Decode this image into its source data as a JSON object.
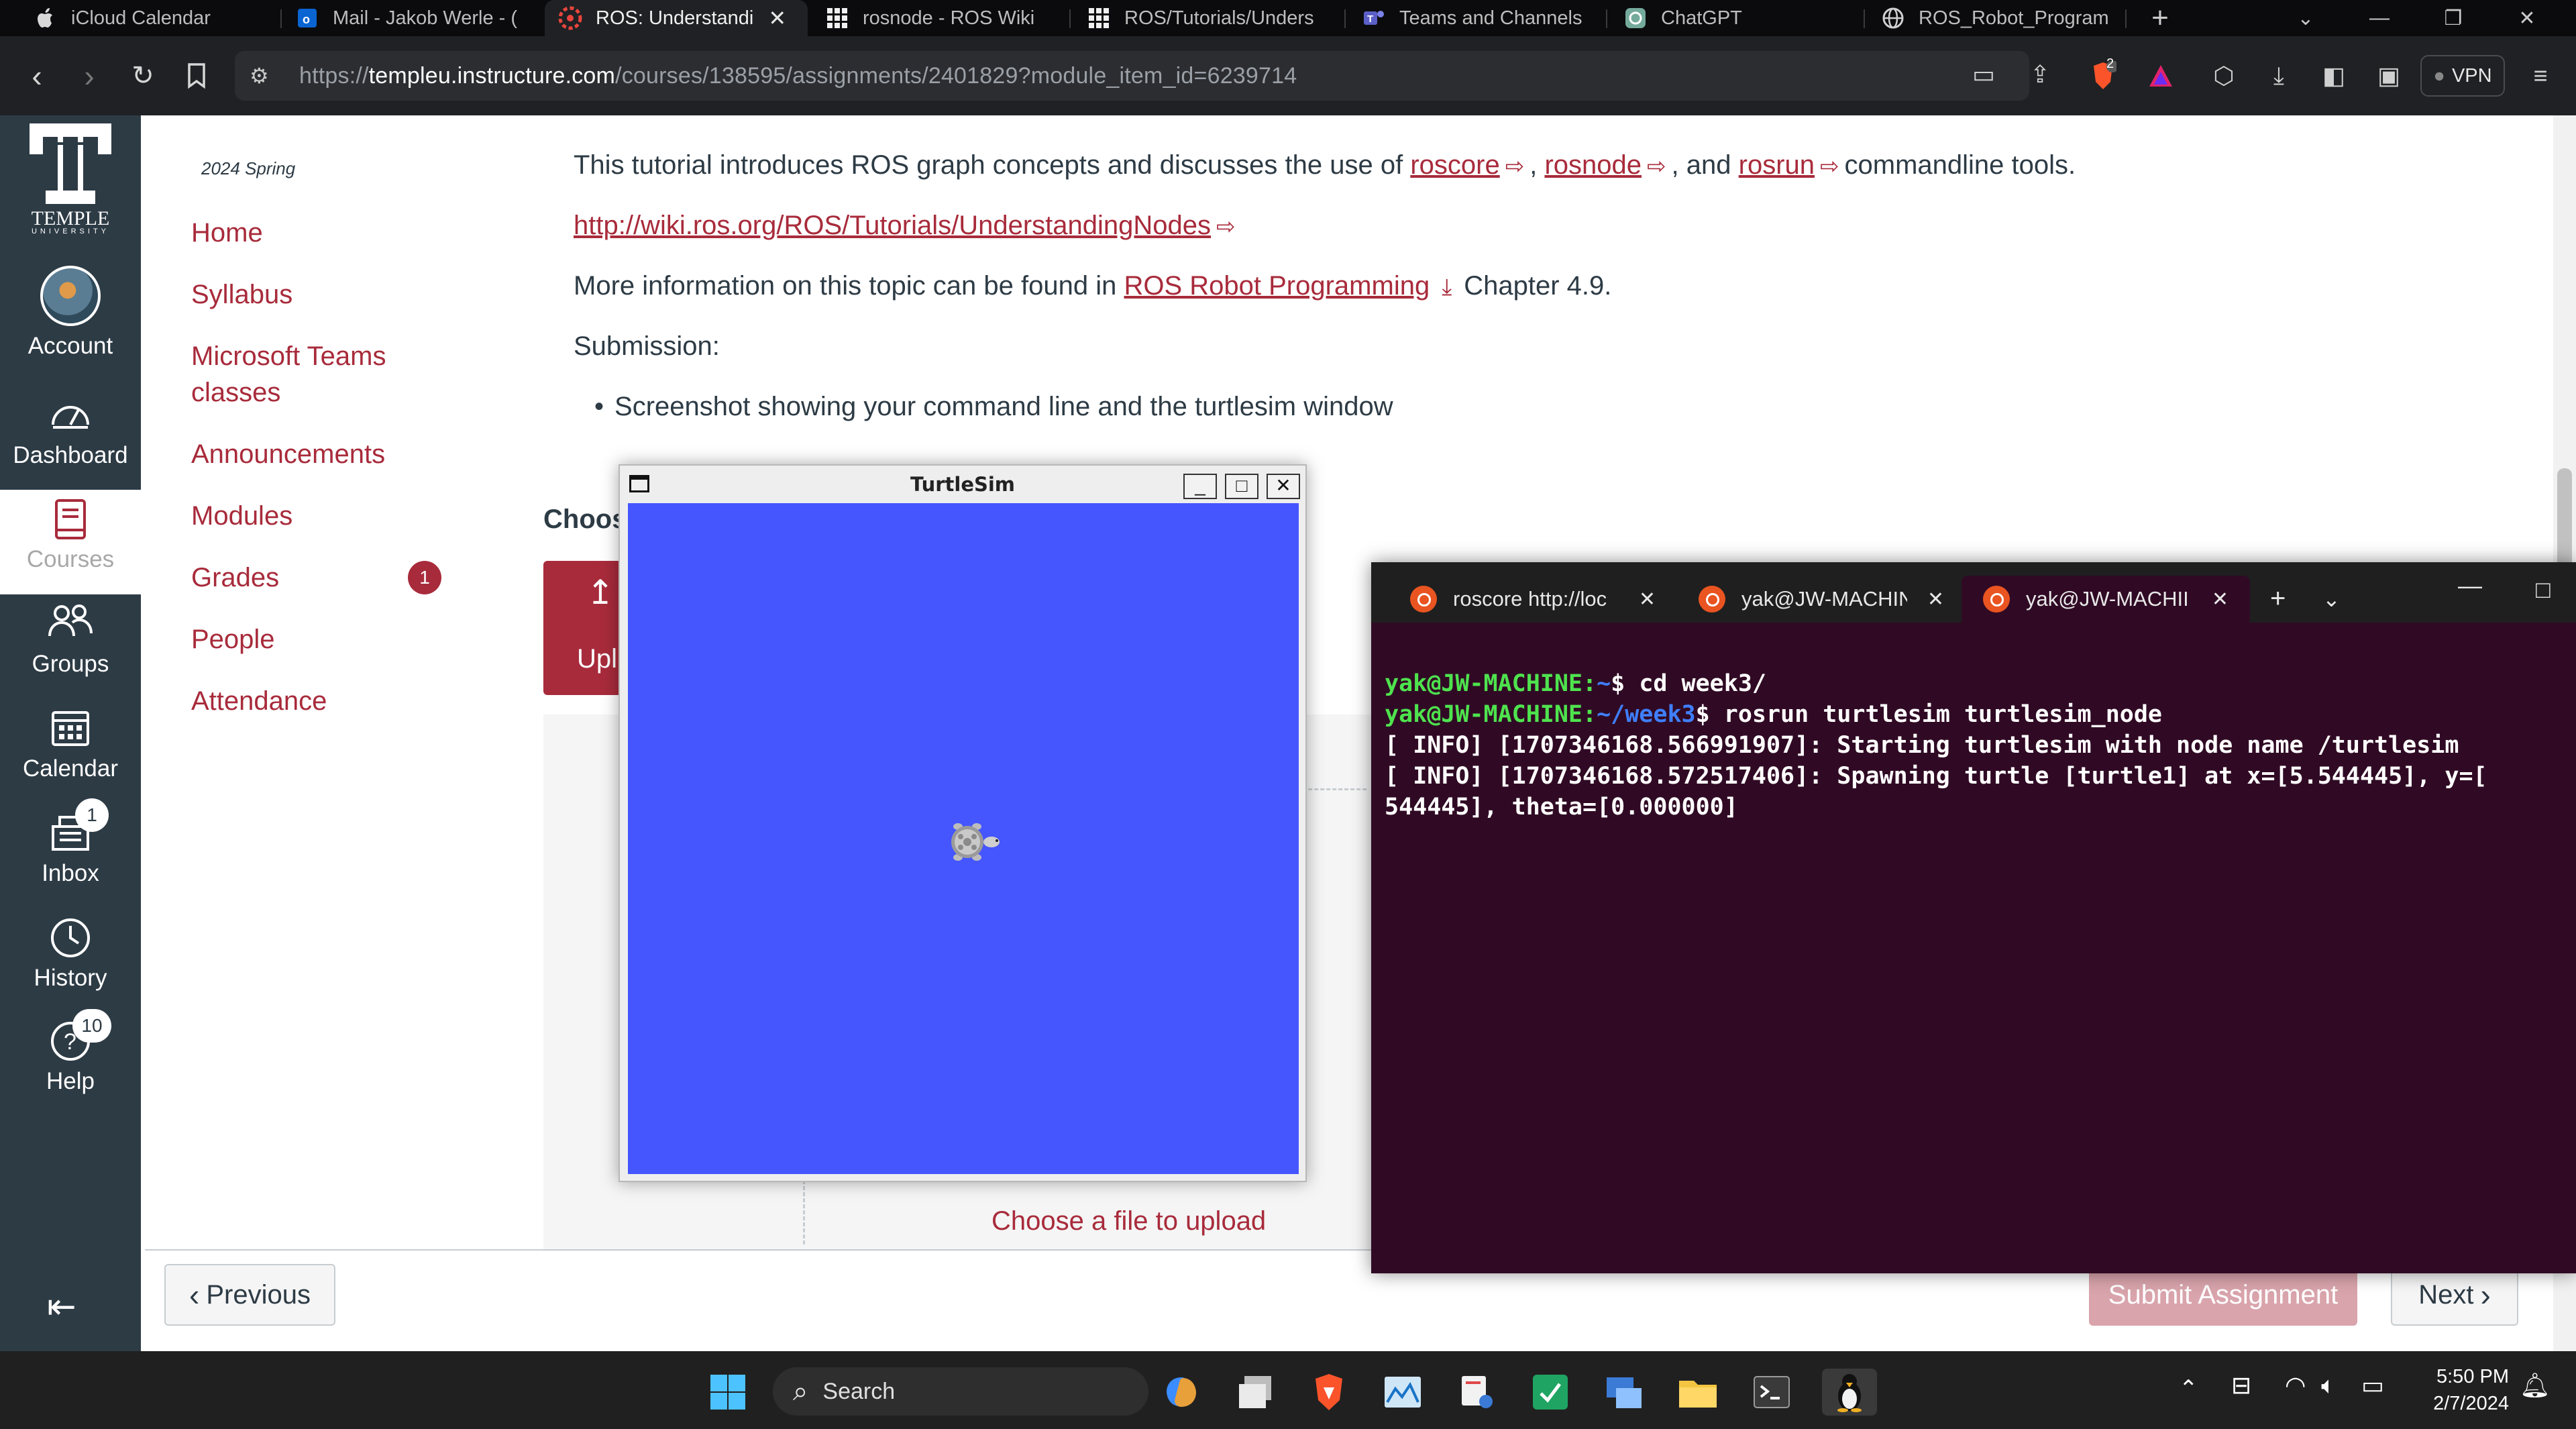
{
  "browser": {
    "tabs": [
      {
        "label": "iCloud Calendar",
        "icon": "apple-icon"
      },
      {
        "label": "Mail - Jakob Werle - (",
        "icon": "outlook-icon"
      },
      {
        "label": "ROS: Understandi",
        "icon": "ros-icon",
        "active": true
      },
      {
        "label": "rosnode - ROS Wiki",
        "icon": "ros-wiki-icon"
      },
      {
        "label": "ROS/Tutorials/Unders",
        "icon": "ros-wiki-icon"
      },
      {
        "label": "Teams and Channels",
        "icon": "teams-icon"
      },
      {
        "label": "ChatGPT",
        "icon": "chatgpt-icon"
      },
      {
        "label": "ROS_Robot_Programm",
        "icon": "globe-icon"
      }
    ],
    "url_prefix": "https://",
    "url_domain": "templeu.instructure.com",
    "url_path": "/courses/138595/assignments/2401829?module_item_id=6239714",
    "vpn_label": "VPN",
    "brave_badge": "2"
  },
  "global_nav": {
    "logo_name": "TEMPLE",
    "logo_sub": "UNIVERSITY",
    "items": [
      {
        "label": "Account",
        "icon": "avatar"
      },
      {
        "label": "Dashboard",
        "icon": "dashboard-icon"
      },
      {
        "label": "Courses",
        "icon": "courses-icon",
        "active": true
      },
      {
        "label": "Groups",
        "icon": "groups-icon"
      },
      {
        "label": "Calendar",
        "icon": "calendar-icon"
      },
      {
        "label": "Inbox",
        "icon": "inbox-icon",
        "badge": "1"
      },
      {
        "label": "History",
        "icon": "history-icon"
      },
      {
        "label": "Help",
        "icon": "help-icon",
        "badge": "10"
      }
    ]
  },
  "course_nav": {
    "term": "2024 Spring",
    "items": [
      "Home",
      "Syllabus",
      "Microsoft Teams",
      "classes",
      "Announcements",
      "Modules",
      "Grades",
      "People",
      "Attendance"
    ],
    "grades_badge": "1"
  },
  "content": {
    "intro_pre": "This tutorial introduces ROS graph concepts and discusses the use of ",
    "link_roscore": "roscore",
    "sep1": ",",
    "link_rosnode": "rosnode",
    "sep2": ", and",
    "link_rosrun": "rosrun",
    "intro_post": "commandline tools.",
    "wiki_link": "http://wiki.ros.org/ROS/Tutorials/UnderstandingNodes",
    "more_pre": "More information on this topic can be found in ",
    "book_link": "ROS Robot Programming",
    "more_post": "Chapter 4.9.",
    "submission_label": "Submission:",
    "bullet": "Screenshot showing your command line and the turtlesim window",
    "choose_partial": "Choos",
    "upload_partial": "Upl",
    "choose_file": "Choose a file to upload"
  },
  "turtlesim": {
    "title": "TurtleSim",
    "bg_color": "#4556ff"
  },
  "terminal": {
    "tabs": [
      "roscore http://loc",
      "yak@JW-MACHIN",
      "yak@JW-MACHII"
    ],
    "lines": [
      {
        "user": "yak@JW-MACHINE",
        "path": "~",
        "cmd": " cd week3/"
      },
      {
        "user": "yak@JW-MACHINE",
        "path": "~/week3",
        "cmd": " rosrun turtlesim turtlesim_node"
      }
    ],
    "output": [
      "[ INFO] [1707346168.566991907]: Starting turtlesim with node name /turtlesim",
      "[ INFO] [1707346168.572517406]: Spawning turtle [turtle1] at x=[5.544445], y=[",
      "544445], theta=[0.000000]"
    ]
  },
  "footer": {
    "previous": "Previous",
    "submit": "Submit Assignment",
    "next": "Next"
  },
  "taskbar": {
    "search_placeholder": "Search",
    "time": "5:50 PM",
    "date": "2/7/2024"
  },
  "colors": {
    "accent": "#a82b3b",
    "nav_bg": "#2d3b45",
    "terminal_bg": "#300a24"
  }
}
